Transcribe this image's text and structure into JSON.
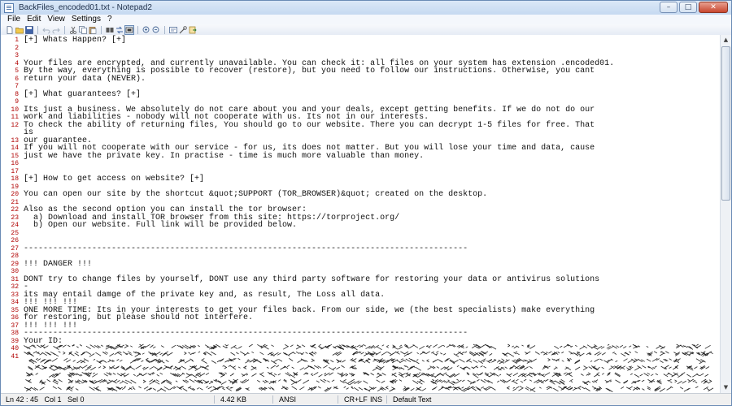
{
  "window": {
    "title": "BackFiles_encoded01.txt - Notepad2",
    "controls": {
      "minimize": "–",
      "maximize": "□",
      "close": "✕"
    }
  },
  "menu": [
    "File",
    "Edit",
    "View",
    "Settings",
    "?"
  ],
  "toolbar": {
    "buttons": [
      "new-icon",
      "open-icon",
      "save-icon",
      "undo-icon",
      "redo-icon",
      "cut-icon",
      "copy-icon",
      "paste-icon",
      "find-icon",
      "replace-icon",
      "word-wrap-icon",
      "zoom-in-icon",
      "zoom-out-icon",
      "scheme-icon",
      "settings-icon",
      "exit-icon"
    ]
  },
  "editor": {
    "lines": [
      {
        "n": "1",
        "t": "[+] Whats Happen? [+]"
      },
      {
        "n": "2",
        "t": ""
      },
      {
        "n": "3",
        "t": ""
      },
      {
        "n": "4",
        "t": "Your files are encrypted, and currently unavailable. You can check it: all files on your system has extension .encoded01."
      },
      {
        "n": "5",
        "t": "By the way, everything is possible to recover (restore), but you need to follow our instructions. Otherwise, you cant"
      },
      {
        "n": "6",
        "t": "return your data (NEVER)."
      },
      {
        "n": "7",
        "t": ""
      },
      {
        "n": "8",
        "t": "[+] What guarantees? [+]"
      },
      {
        "n": "9",
        "t": ""
      },
      {
        "n": "10",
        "t": "Its just a business. We absolutely do not care about you and your deals, except getting benefits. If we do not do our"
      },
      {
        "n": "11",
        "t": "work and liabilities - nobody will not cooperate with us. Its not in our interests."
      },
      {
        "n": "12",
        "t": "To check the ability of returning files, You should go to our website. There you can decrypt 1-5 files for free. That"
      },
      {
        "n": "",
        "t": "is"
      },
      {
        "n": "13",
        "t": "our guarantee."
      },
      {
        "n": "14",
        "t": "If you will not cooperate with our service - for us, its does not matter. But you will lose your time and data, cause"
      },
      {
        "n": "15",
        "t": "just we have the private key. In practise - time is much more valuable than money."
      },
      {
        "n": "16",
        "t": ""
      },
      {
        "n": "17",
        "t": ""
      },
      {
        "n": "18",
        "t": "[+] How to get access on website? [+]"
      },
      {
        "n": "19",
        "t": ""
      },
      {
        "n": "20",
        "t": "You can open our site by the shortcut &quot;SUPPORT (TOR_BROWSER)&quot; created on the desktop."
      },
      {
        "n": "21",
        "t": ""
      },
      {
        "n": "22",
        "t": "Also as the second option you can install the tor browser:"
      },
      {
        "n": "23",
        "t": "  a) Download and install TOR browser from this site: https://torproject.org/"
      },
      {
        "n": "24",
        "t": "  b) Open our website. Full link will be provided below."
      },
      {
        "n": "25",
        "t": ""
      },
      {
        "n": "26",
        "t": ""
      },
      {
        "n": "27",
        "t": "-------------------------------------------------------------------------------------------"
      },
      {
        "n": "28",
        "t": ""
      },
      {
        "n": "29",
        "t": "!!! DANGER !!!"
      },
      {
        "n": "30",
        "t": ""
      },
      {
        "n": "31",
        "t": "DONT try to change files by yourself, DONT use any third party software for restoring your data or antivirus solutions"
      },
      {
        "n": "32",
        "t": "-"
      },
      {
        "n": "33",
        "t": "its may entail damge of the private key and, as result, The Loss all data."
      },
      {
        "n": "34",
        "t": "!!! !!! !!!"
      },
      {
        "n": "35",
        "t": "ONE MORE TIME: Its in your interests to get your files back. From our side, we (the best specialists) make everything"
      },
      {
        "n": "36",
        "t": "for restoring, but please should not interfere."
      },
      {
        "n": "37",
        "t": "!!! !!! !!!"
      },
      {
        "n": "38",
        "t": "-------------------------------------------------------------------------------------------"
      },
      {
        "n": "39",
        "t": "Your ID:"
      },
      {
        "n": "40",
        "t": ""
      },
      {
        "n": "41",
        "t": ""
      }
    ]
  },
  "status": {
    "position": "Ln 42 : 45   Col 1   Sel 0",
    "size": "4.42 KB",
    "encoding": "ANSI",
    "line_endings": "CR+LF",
    "mode": "INS",
    "scheme": "Default Text"
  }
}
